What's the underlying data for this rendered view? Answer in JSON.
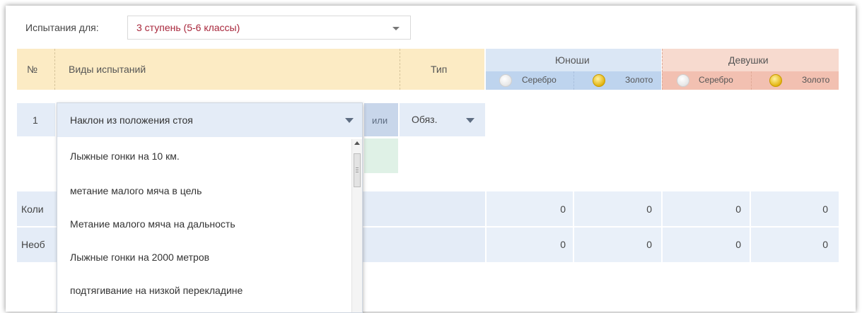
{
  "filter": {
    "label": "Испытания для:",
    "value": "3 ступень (5-6 классы)"
  },
  "table": {
    "headers": {
      "num": "№",
      "kind": "Виды испытаний",
      "type": "Тип"
    },
    "groups": [
      {
        "name": "Юноши",
        "silver": "Серебро",
        "gold": "Золото"
      },
      {
        "name": "Девушки",
        "silver": "Серебро",
        "gold": "Золото"
      }
    ],
    "row1": {
      "num": "1",
      "selected": "Наклон из положения стоя",
      "or": "или",
      "type": "Обяз."
    },
    "row_count": {
      "label_visible": "Коли",
      "values": [
        "0",
        "0",
        "0",
        "0"
      ]
    },
    "row_required": {
      "label_visible": "Необ",
      "values": [
        "0",
        "0",
        "0",
        "0"
      ]
    }
  },
  "dropdown": {
    "options": [
      "Лыжные гонки на 10 км.",
      "метание малого мяча в цель",
      "Метание малого мяча на дальность",
      "Лыжные гонки на 2000 метров",
      "подтягивание на низкой перекладине"
    ]
  },
  "colors": {
    "accent_text": "#a8263b",
    "boys_header": "#dbe7f5",
    "girls_header": "#f7dacf",
    "main_header": "#fcebc4"
  }
}
